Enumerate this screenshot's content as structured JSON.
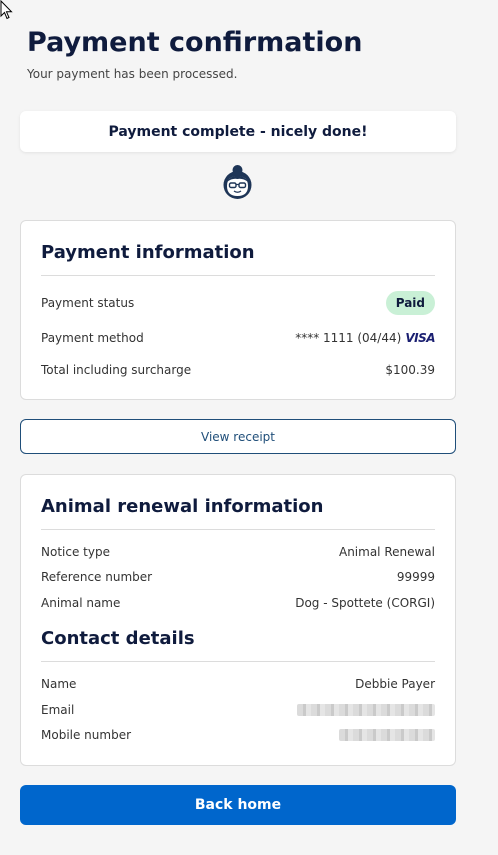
{
  "header": {
    "title": "Payment confirmation",
    "subtitle": "Your payment has been processed."
  },
  "banner": {
    "text": "Payment complete - nicely done!"
  },
  "payment_info": {
    "heading": "Payment information",
    "rows": [
      {
        "label": "Payment status",
        "value": "Paid"
      },
      {
        "label": "Payment method",
        "value": "**** 1111 (04/44)",
        "card_brand": "VISA"
      },
      {
        "label": "Total including surcharge",
        "value": "$100.39"
      }
    ]
  },
  "receipt_button": {
    "label": "View receipt"
  },
  "animal_info": {
    "heading": "Animal renewal information",
    "rows": [
      {
        "label": "Notice type",
        "value": "Animal Renewal"
      },
      {
        "label": "Reference number",
        "value": "99999"
      },
      {
        "label": "Animal name",
        "value": "Dog - Spottete (CORGI)"
      }
    ]
  },
  "contact": {
    "heading": "Contact details",
    "rows": [
      {
        "label": "Name",
        "value": "Debbie Payer"
      },
      {
        "label": "Email",
        "value": ""
      },
      {
        "label": "Mobile number",
        "value": ""
      }
    ]
  },
  "home_button": {
    "label": "Back home"
  },
  "icons": {
    "avatar": "avatar-icon",
    "cursor": "mouse-cursor-icon"
  },
  "colors": {
    "primary": "#0066cc",
    "heading": "#0f1b3d",
    "paid_badge": "#c9f0d6",
    "outline": "#1f4e79"
  }
}
